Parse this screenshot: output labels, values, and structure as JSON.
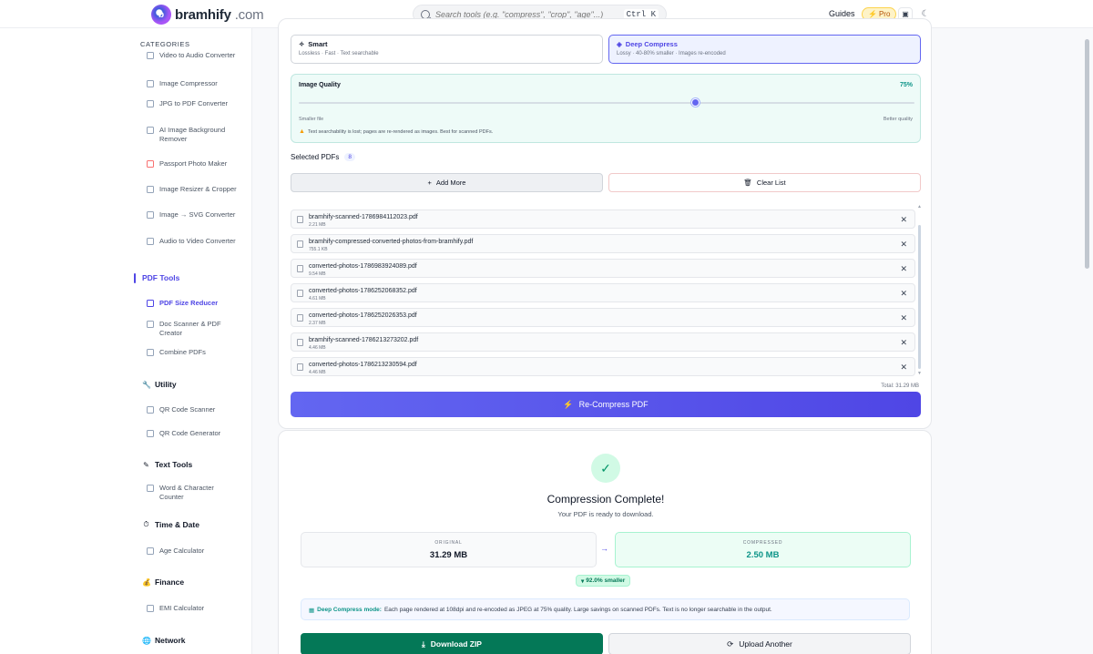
{
  "header": {
    "logo_text": "bramhify",
    "logo_tld": ".com",
    "search_placeholder": "Search tools (e.g. \"compress\", \"crop\", \"age\"...)",
    "shortcut": "Ctrl K",
    "guides": "Guides",
    "pro": "Pro"
  },
  "sidebar": {
    "categories_title": "CATEGORIES",
    "items": [
      {
        "label": "Video to Audio Converter"
      },
      {
        "label": "Image Compressor"
      },
      {
        "label": "JPG to PDF Converter"
      },
      {
        "label": "AI Image Background Remover"
      },
      {
        "label": "Passport Photo Maker"
      },
      {
        "label": "Image Resizer & Cropper"
      },
      {
        "label": "Image → SVG Converter"
      },
      {
        "label": "Audio to Video Converter"
      }
    ],
    "groups": {
      "pdf": "PDF Tools",
      "utility": "Utility",
      "text": "Text Tools",
      "time": "Time & Date",
      "finance": "Finance",
      "network": "Network"
    },
    "pdf_items": [
      "PDF Size Reducer",
      "Doc Scanner & PDF Creator",
      "Combine PDFs"
    ],
    "utility_items": [
      "QR Code Scanner",
      "QR Code Generator"
    ],
    "text_items": [
      "Word & Character Counter"
    ],
    "time_items": [
      "Age Calculator"
    ],
    "finance_items": [
      "EMI Calculator"
    ]
  },
  "modes": {
    "smart": {
      "name": "Smart",
      "desc": "Lossless · Fast · Text searchable"
    },
    "deep": {
      "name": "Deep Compress",
      "desc": "Lossy · 40-80% smaller · Images re-encoded"
    }
  },
  "quality": {
    "label": "Image Quality",
    "value_text": "75%",
    "value": 75,
    "min_label": "Smaller file",
    "max_label": "Better quality",
    "warning": "Text searchability is lost; pages are re-rendered as images. Best for scanned PDFs."
  },
  "selected": {
    "title": "Selected PDFs",
    "count": "8"
  },
  "buttons": {
    "add_more": "Add More",
    "clear_list": "Clear List",
    "recompress": "Re-Compress PDF",
    "download": "Download ZIP",
    "upload_another": "Upload Another"
  },
  "files": [
    {
      "name": "bramhify-scanned-1786984112023.pdf",
      "size": "2.21 MB"
    },
    {
      "name": "bramhify-compressed-converted-photos-from-bramhify.pdf",
      "size": "755.1 KB"
    },
    {
      "name": "converted-photos-1786983924089.pdf",
      "size": "9.54 MB"
    },
    {
      "name": "converted-photos-1786252068352.pdf",
      "size": "4.61 MB"
    },
    {
      "name": "converted-photos-1786252026353.pdf",
      "size": "2.37 MB"
    },
    {
      "name": "bramhify-scanned-1786213273202.pdf",
      "size": "4.46 MB"
    },
    {
      "name": "converted-photos-1786213230594.pdf",
      "size": "4.46 MB"
    }
  ],
  "total": "Total: 31.29 MB",
  "result": {
    "title": "Compression Complete!",
    "subtitle": "Your PDF is ready to download.",
    "original_label": "ORIGINAL",
    "original_value": "31.29 MB",
    "compressed_label": "COMPRESSED",
    "compressed_value": "2.50 MB",
    "reduction": "92.0% smaller",
    "note_mode": "Deep Compress mode:",
    "note_text": "Each page rendered at 108dpi and re-encoded as JPEG at 75% quality. Large savings on scanned PDFs. Text is no longer searchable in the output."
  },
  "colors": {
    "accent": "#4f46e5",
    "success": "#047857",
    "teal": "#0d9488"
  }
}
